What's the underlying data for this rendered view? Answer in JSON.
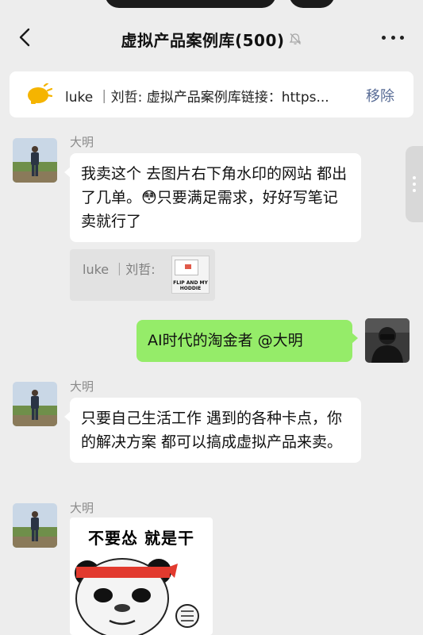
{
  "header": {
    "title": "虚拟产品案例库",
    "member_count": "(500)"
  },
  "pinned": {
    "text": "luke ｜刘哲: 虚拟产品案例库链接：https...",
    "remove_label": "移除"
  },
  "messages": [
    {
      "sender": "大明",
      "text": "我卖这个 去图片右下角水印的网站 都出了几单。😳只要满足需求，好好写笔记卖就行了"
    },
    {
      "quote_label": "luke ｜刘哲:",
      "quote_thumb_caption": "FLIP AND MY HODDIE"
    },
    {
      "text": "AI时代的淘金者 @大明"
    },
    {
      "sender": "大明",
      "text": "只要自己生活工作 遇到的各种卡点，你的解决方案 都可以搞成虚拟产品来卖。"
    },
    {
      "sender": "大明",
      "sticker_caption": "不要怂 就是干"
    }
  ],
  "colors": {
    "own_bubble": "#95ec69",
    "link_blue": "#576b95",
    "background": "#ededed"
  }
}
